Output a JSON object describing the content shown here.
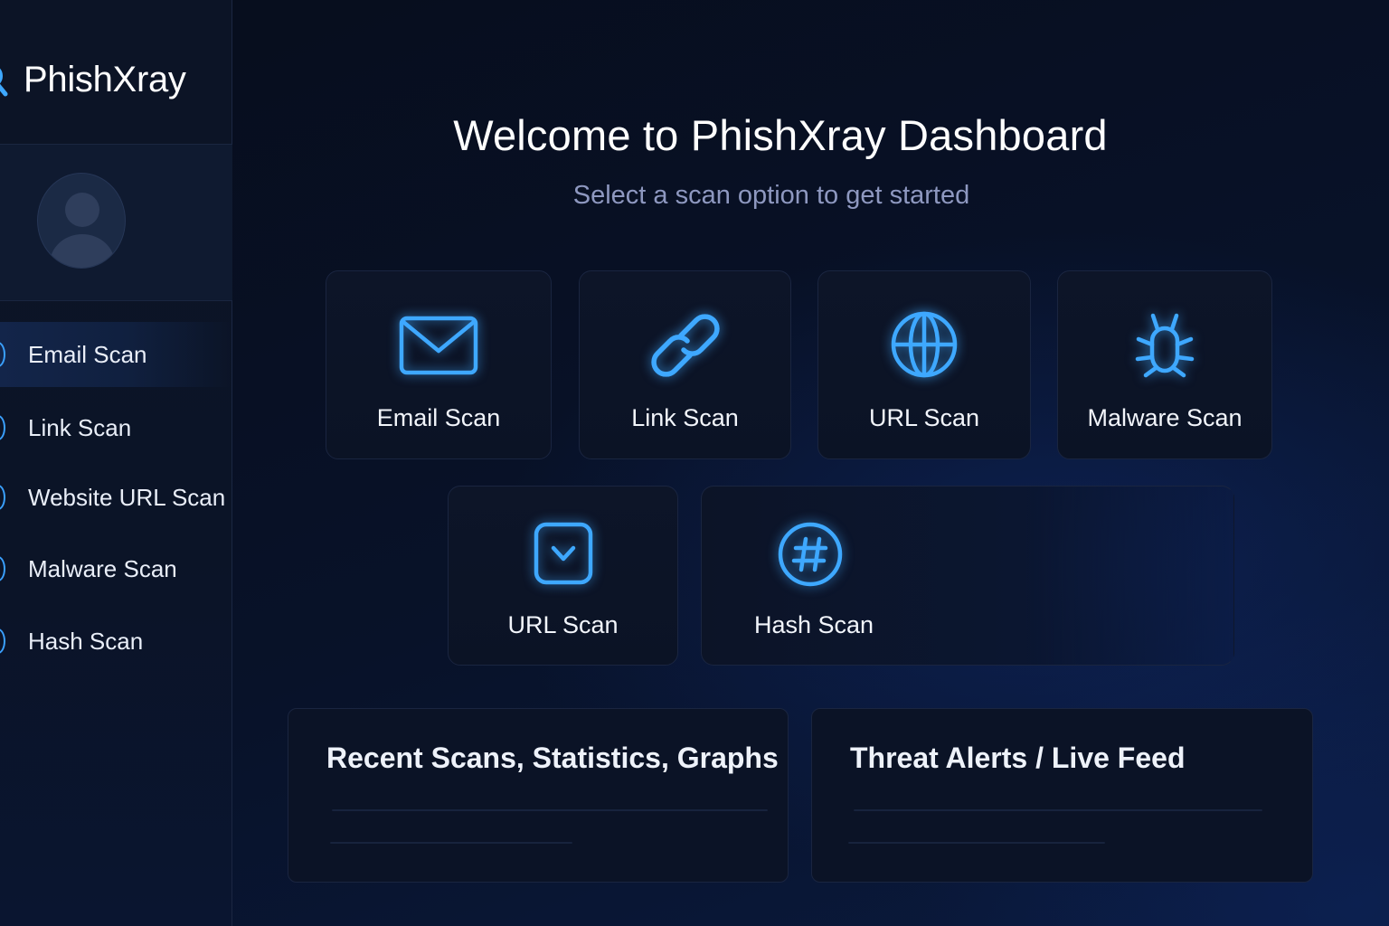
{
  "app": {
    "name": "PhishXray"
  },
  "sidebar": {
    "items": [
      {
        "label": "Email Scan",
        "active": true
      },
      {
        "label": "Link Scan",
        "active": false
      },
      {
        "label": "Website URL Scan",
        "active": false
      },
      {
        "label": "Malware Scan",
        "active": false
      },
      {
        "label": "Hash Scan",
        "active": false
      }
    ]
  },
  "main": {
    "title": "Welcome to PhishXray Dashboard",
    "subtitle": "Select a scan option to get started",
    "cards": [
      {
        "label": "Email Scan",
        "icon": "envelope-icon"
      },
      {
        "label": "Link Scan",
        "icon": "link-icon"
      },
      {
        "label": "URL Scan",
        "icon": "globe-icon"
      },
      {
        "label": "Malware Scan",
        "icon": "bug-icon"
      },
      {
        "label": "URL Scan",
        "icon": "chevron-square-icon"
      },
      {
        "label": "Hash Scan",
        "icon": "hash-icon"
      }
    ],
    "panels": [
      {
        "title": "Recent Scans, Statistics, Graphs"
      },
      {
        "title": "Threat Alerts / Live Feed"
      }
    ]
  },
  "colors": {
    "accent": "#3ea8ff",
    "background": "#081229",
    "sidebar": "#0c1426",
    "card": "#0d1528",
    "subtitle": "#8e98c0"
  }
}
